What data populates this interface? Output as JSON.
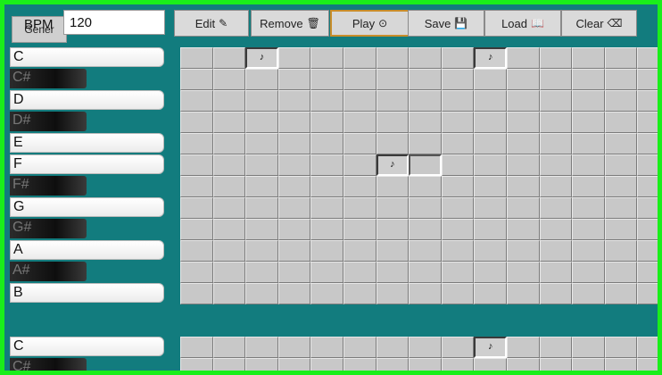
{
  "toolbar": {
    "behind_label": "Gener",
    "bpm_label": "BPM",
    "bpm_value": "120",
    "edit": {
      "label": "Edit",
      "icon": "✎"
    },
    "remove": {
      "label": "Remove",
      "icon": "🗑"
    },
    "play": {
      "label": "Play",
      "icon": "⊙"
    },
    "save": {
      "label": "Save",
      "icon": "💾"
    },
    "load": {
      "label": "Load",
      "icon": "📖"
    },
    "clear": {
      "label": "Clear",
      "icon": "⌫"
    }
  },
  "note_symbol": "♪",
  "keys_octave1": [
    "C",
    "C#",
    "D",
    "D#",
    "E",
    "F",
    "F#",
    "G",
    "G#",
    "A",
    "A#",
    "B"
  ],
  "keys_octave2": [
    "C",
    "C#"
  ],
  "grid_octave1": {
    "rows": 12,
    "cols": 15,
    "notes": [
      [
        0,
        2
      ],
      [
        0,
        9
      ],
      [
        5,
        6
      ]
    ],
    "selected": [
      [
        5,
        7
      ]
    ]
  },
  "grid_octave2": {
    "rows": 2,
    "cols": 15,
    "notes": [
      [
        0,
        9
      ]
    ],
    "selected": []
  }
}
